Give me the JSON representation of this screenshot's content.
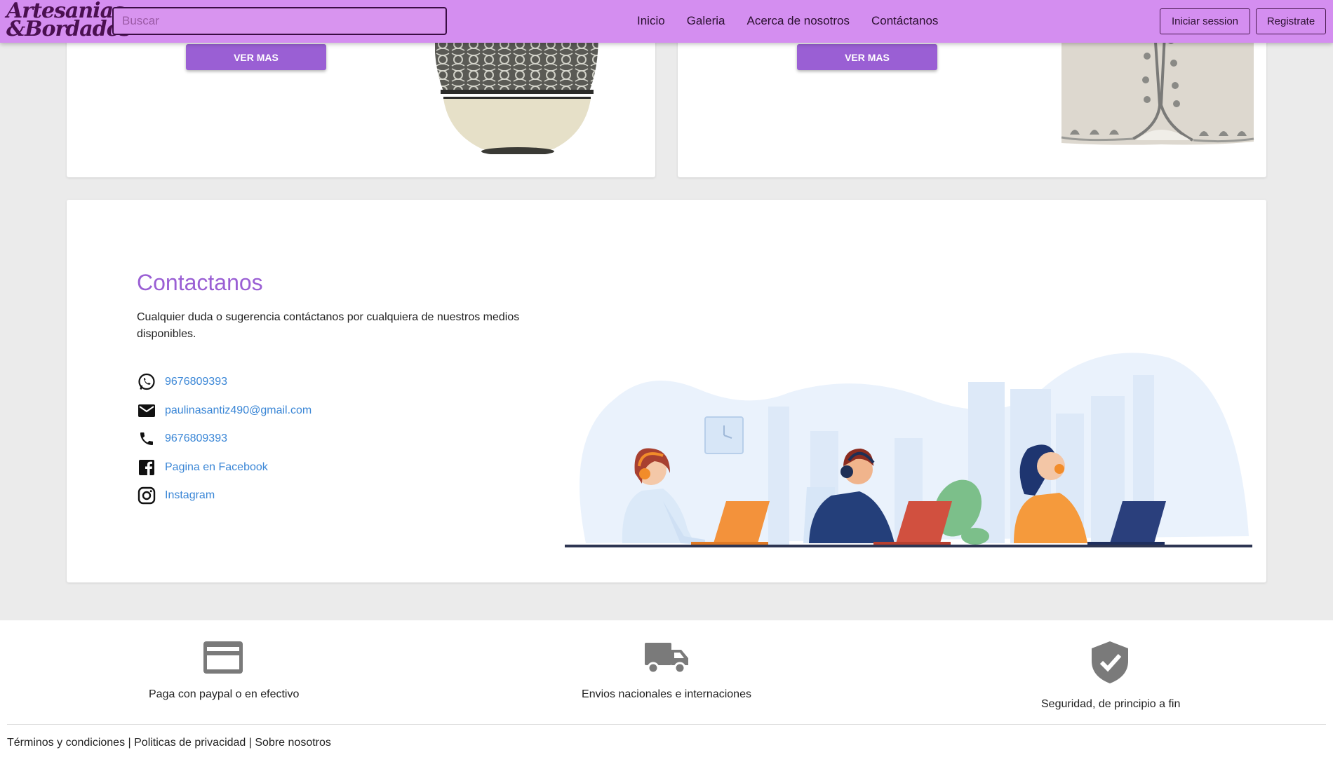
{
  "navbar": {
    "logo_line1": "Artesanias",
    "logo_line2": "&Bordados",
    "search_placeholder": "Buscar",
    "links": [
      "Inicio",
      "Galeria",
      "Acerca de nosotros",
      "Contáctanos"
    ],
    "login_label": "Iniciar session",
    "register_label": "Registrate"
  },
  "products": [
    {
      "button_label": "VER MAS"
    },
    {
      "button_label": "VER MAS"
    }
  ],
  "contact": {
    "title": "Contactanos",
    "description": "Cualquier duda o sugerencia contáctanos por cualquiera de nuestros medios disponibles.",
    "items": [
      {
        "icon": "whatsapp-icon",
        "text": "9676809393"
      },
      {
        "icon": "email-icon",
        "text": "paulinasantiz490@gmail.com"
      },
      {
        "icon": "phone-icon",
        "text": "9676809393"
      },
      {
        "icon": "facebook-icon",
        "text": "Pagina en Facebook"
      },
      {
        "icon": "instagram-icon",
        "text": "Instagram"
      }
    ]
  },
  "footer": {
    "features": [
      {
        "icon": "credit-card-icon",
        "label": "Paga con paypal o en efectivo"
      },
      {
        "icon": "truck-icon",
        "label": "Envios nacionales e internaciones"
      },
      {
        "icon": "shield-check-icon",
        "label": "Seguridad, de principio a fin"
      }
    ],
    "links": [
      "Términos y condiciones",
      "Politicas de privacidad",
      "Sobre nosotros"
    ],
    "separator": " | "
  },
  "colors": {
    "navbar": "#d48ef0",
    "accent": "#9a5fd4",
    "link": "#3a86d6",
    "background": "#ebebeb"
  }
}
